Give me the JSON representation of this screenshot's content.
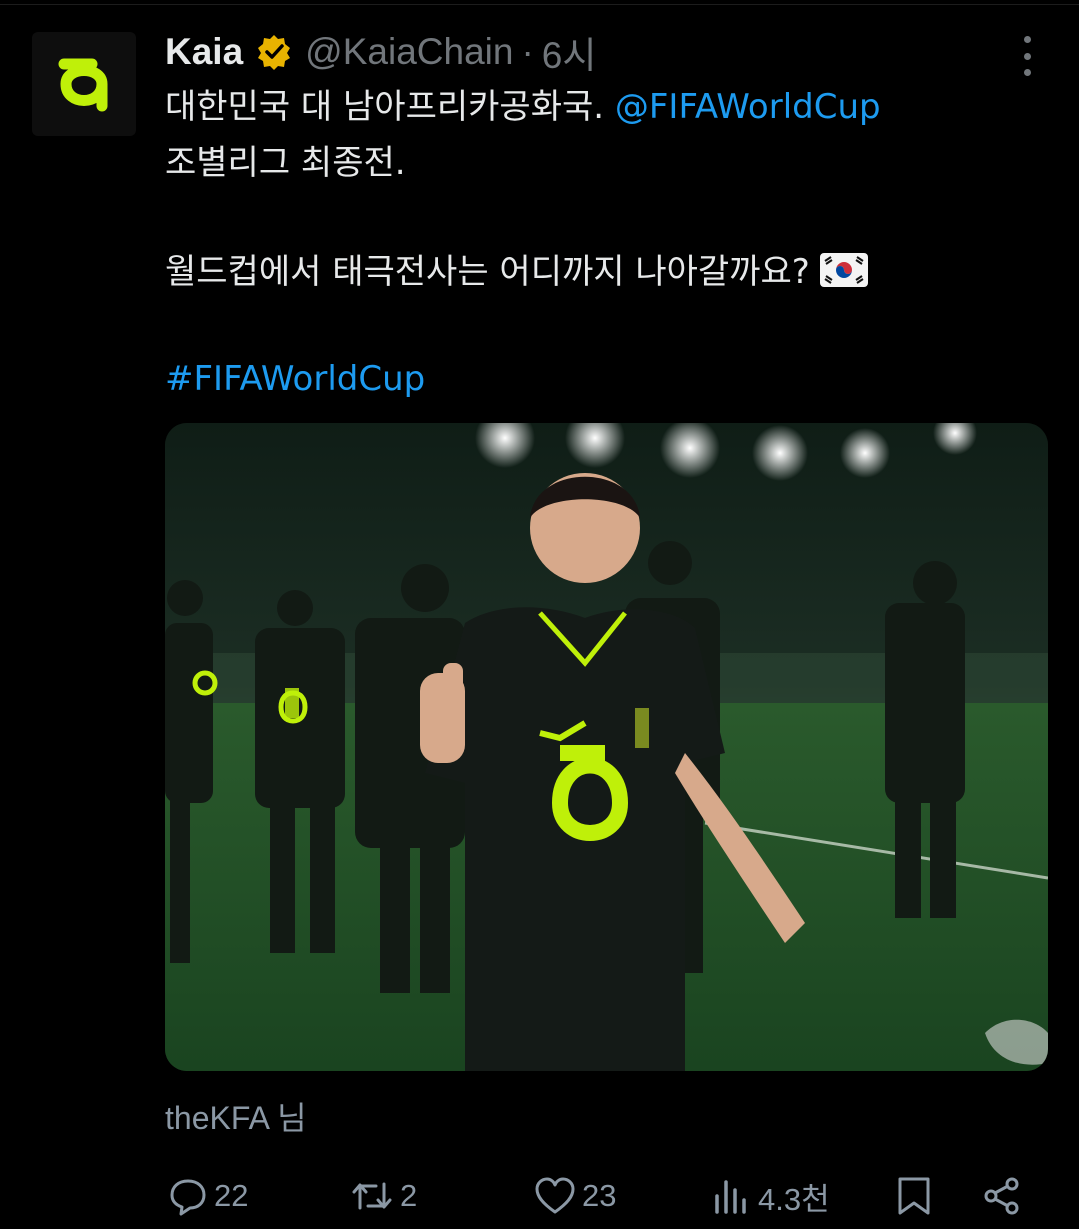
{
  "author": {
    "display_name": "Kaia",
    "handle": "@KaiaChain",
    "separator": "·",
    "time": "6시",
    "verified": true,
    "avatar_icon": "kaia-logo-icon",
    "brand_color": "#bff009"
  },
  "body": {
    "line1_text": "대한민국 대 남아프리카공화국. ",
    "line1_mention": "@FIFAWorldCup",
    "line2_text": "조별리그 최종전.",
    "line3_text": "월드컵에서 태극전사는 어디까지 나아갈까요?",
    "line3_emoji": "south-korea-flag-icon",
    "hashtag": "#FIFAWorldCup",
    "link_color": "#1d9bf0"
  },
  "media": {
    "description_icon": "football-player-photo",
    "tag_credit": "theKFA 님"
  },
  "actions": {
    "reply_count": "22",
    "repost_count": "2",
    "like_count": "23",
    "views_count": "4.3천"
  }
}
